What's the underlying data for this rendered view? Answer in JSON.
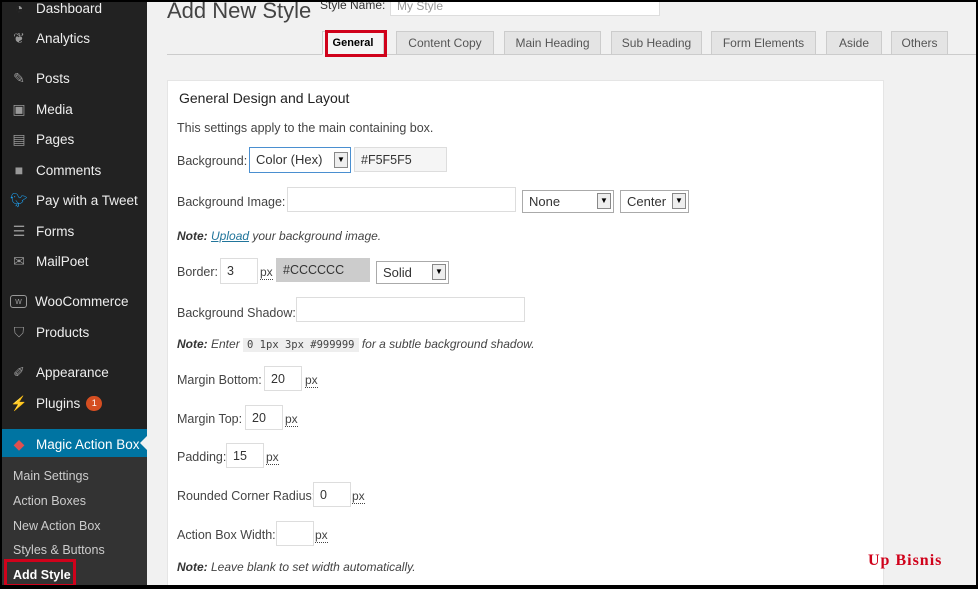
{
  "sidebar": {
    "items": [
      {
        "label": "Dashboard",
        "icon": "dashboard-icon"
      },
      {
        "label": "Analytics",
        "icon": "analytics-icon"
      },
      {
        "label": "Posts",
        "icon": "pin-icon"
      },
      {
        "label": "Media",
        "icon": "media-icon"
      },
      {
        "label": "Pages",
        "icon": "pages-icon"
      },
      {
        "label": "Comments",
        "icon": "comment-icon"
      },
      {
        "label": "Pay with a Tweet",
        "icon": "twitter-icon"
      },
      {
        "label": "Forms",
        "icon": "forms-icon"
      },
      {
        "label": "MailPoet",
        "icon": "mail-icon"
      },
      {
        "label": "WooCommerce",
        "icon": "woo-icon"
      },
      {
        "label": "Products",
        "icon": "cart-icon"
      },
      {
        "label": "Appearance",
        "icon": "brush-icon"
      },
      {
        "label": "Plugins",
        "icon": "plug-icon",
        "badge": "1"
      },
      {
        "label": "Magic Action Box",
        "icon": "cube-icon"
      }
    ],
    "submenu": [
      "Main Settings",
      "Action Boxes",
      "New Action Box",
      "Styles & Buttons",
      "Add Style"
    ]
  },
  "page": {
    "title": "Add New Style",
    "style_name_label": "Style Name:",
    "style_name_value": "My Style"
  },
  "tabs": [
    "General",
    "Content Copy",
    "Main Heading",
    "Sub Heading",
    "Form Elements",
    "Aside",
    "Others"
  ],
  "panel": {
    "heading": "General Design and Layout",
    "intro": "This settings apply to the main containing box.",
    "background_label": "Background:",
    "background_type": "Color (Hex)",
    "background_color": "#F5F5F5",
    "bg_image_label": "Background Image:",
    "bg_image_value": "",
    "bg_repeat": "None",
    "bg_position": "Center",
    "note_label": "Note:",
    "note_upload_link": "Upload",
    "note_upload_rest": " your background image.",
    "border_label": "Border:",
    "border_width": "3",
    "border_color": "#CCCCCC",
    "border_style": "Solid",
    "px": "px",
    "bg_shadow_label": "Background Shadow:",
    "bg_shadow_value": "",
    "shadow_note_pre": " Enter ",
    "shadow_note_code": "0 1px 3px #999999",
    "shadow_note_post": " for a subtle background shadow.",
    "margin_bottom_label": "Margin Bottom:",
    "margin_bottom": "20",
    "margin_top_label": "Margin Top:",
    "margin_top": "20",
    "padding_label": "Padding:",
    "padding": "15",
    "radius_label": "Rounded Corner Radius:",
    "radius": "0",
    "width_label": "Action Box Width:",
    "width": "",
    "width_note": " Leave blank to set width automatically."
  },
  "watermark": "Up Bisnis",
  "colors": {
    "sidebar_bg": "#222222",
    "active": "#0074a2",
    "highlight": "#d0021b",
    "badge": "#d54e21"
  }
}
